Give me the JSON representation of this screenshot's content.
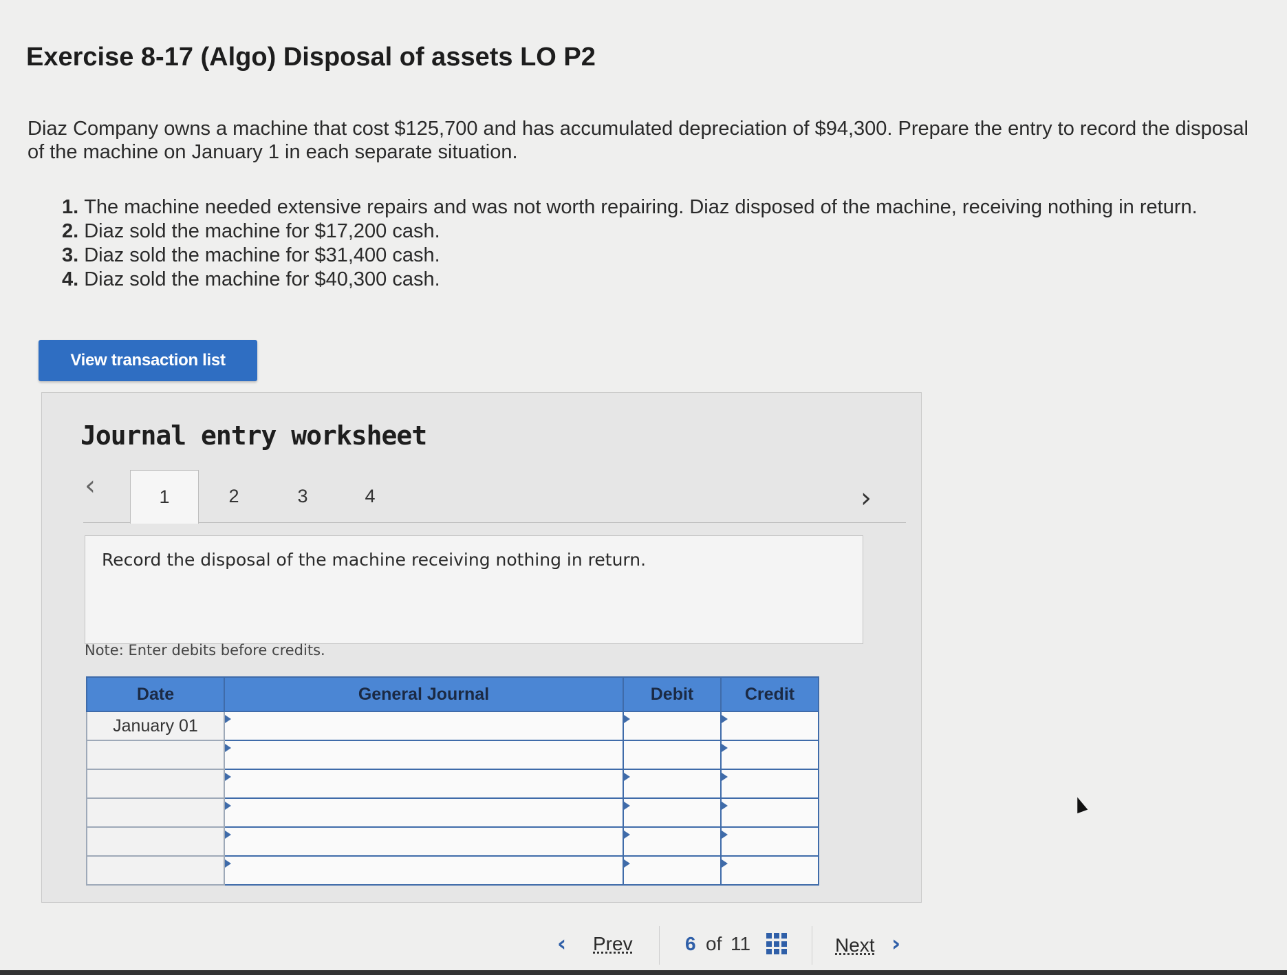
{
  "page": {
    "title": "Exercise 8-17 (Algo) Disposal of assets LO P2",
    "intro": "Diaz Company owns a machine that cost $125,700 and has accumulated depreciation of $94,300. Prepare the entry to record the disposal of the machine on January 1 in each separate situation.",
    "situations": [
      {
        "num": "1.",
        "text": "The machine needed extensive repairs and was not worth repairing. Diaz disposed of the machine, receiving nothing in return."
      },
      {
        "num": "2.",
        "text": "Diaz sold the machine for $17,200 cash."
      },
      {
        "num": "3.",
        "text": "Diaz sold the machine for $31,400 cash."
      },
      {
        "num": "4.",
        "text": "Diaz sold the machine for $40,300 cash."
      }
    ]
  },
  "toolbar": {
    "view_transaction_list_label": "View transaction list"
  },
  "worksheet": {
    "title": "Journal entry worksheet",
    "prev_glyph": "‹",
    "next_glyph": "›",
    "tabs": [
      {
        "label": "1",
        "active": true
      },
      {
        "label": "2",
        "active": false
      },
      {
        "label": "3",
        "active": false
      },
      {
        "label": "4",
        "active": false
      }
    ],
    "instruction": "Record the disposal of the machine receiving nothing in return.",
    "note": "Note: Enter debits before credits."
  },
  "journal": {
    "headers": {
      "date": "Date",
      "general_journal": "General Journal",
      "debit": "Debit",
      "credit": "Credit"
    },
    "rows": [
      {
        "date": "January 01",
        "account": "",
        "debit": "",
        "credit": ""
      },
      {
        "date": "",
        "account": "",
        "debit": "",
        "credit": ""
      },
      {
        "date": "",
        "account": "",
        "debit": "",
        "credit": ""
      },
      {
        "date": "",
        "account": "",
        "debit": "",
        "credit": ""
      },
      {
        "date": "",
        "account": "",
        "debit": "",
        "credit": ""
      },
      {
        "date": "",
        "account": "",
        "debit": "",
        "credit": ""
      }
    ]
  },
  "pager": {
    "prev_label": "Prev",
    "current": "6",
    "of_label": "of",
    "total": "11",
    "next_label": "Next",
    "grid_icon": "grid-icon"
  },
  "colors": {
    "accent": "#2f6ec2",
    "table_header": "#4b86d4",
    "table_border": "#3f6ba9"
  }
}
